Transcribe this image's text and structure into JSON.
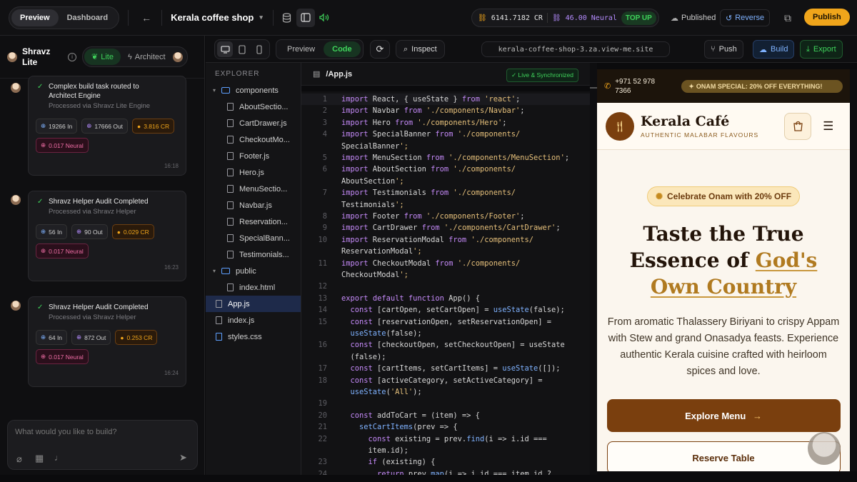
{
  "topbar": {
    "mode_tabs": [
      "Preview",
      "Dashboard"
    ],
    "project_name": "Kerala coffee shop",
    "credits": "6141.7182 CR",
    "neural": "46.00 Neural",
    "topup_label": "TOP UP",
    "published_label": "Published",
    "reverse_label": "Reverse",
    "publish_label": "Publish"
  },
  "chat": {
    "agent_name": "Shravz Lite",
    "modes": [
      "Lite",
      "Architect"
    ],
    "messages": [
      {
        "title": "Complex build task routed to Architect Engine",
        "sub": "Processed via Shravz Lite Engine",
        "tokens_in": "19266 In",
        "tokens_out": "17666 Out",
        "cr": "3.816 CR",
        "neural": "0.017 Neural",
        "time": "16:18"
      },
      {
        "title": "Shravz Helper Audit Completed",
        "sub": "Processed via Shravz Helper",
        "tokens_in": "56 In",
        "tokens_out": "90 Out",
        "cr": "0.029 CR",
        "neural": "0.017 Neural",
        "time": "16:23"
      },
      {
        "title": "Shravz Helper Audit Completed",
        "sub": "Processed via Shravz Helper",
        "tokens_in": "64 In",
        "tokens_out": "872 Out",
        "cr": "0.253 CR",
        "neural": "0.017 Neural",
        "time": "16:24"
      }
    ],
    "composer_placeholder": "What would you like to build?"
  },
  "previewbar": {
    "view_tabs": [
      "Preview",
      "Code"
    ],
    "inspect_label": "Inspect",
    "url": "kerala-coffee-shop-3.za.view-me.site",
    "push_label": "Push",
    "build_label": "Build",
    "export_label": "Export"
  },
  "explorer": {
    "header": "EXPLORER",
    "folder_components": "components",
    "components": [
      "AboutSectio...",
      "CartDrawer.js",
      "CheckoutMo...",
      "Footer.js",
      "Hero.js",
      "MenuSectio...",
      "Navbar.js",
      "Reservation...",
      "SpecialBann...",
      "Testimonials..."
    ],
    "folder_public": "public",
    "public": [
      "index.html"
    ],
    "root": [
      "App.js",
      "index.js",
      "styles.css"
    ]
  },
  "editor": {
    "file": "/App.js",
    "status": "Live & Synchronized",
    "lines": [
      {
        "n": "1",
        "text": "import React, { useState } from 'react';"
      },
      {
        "n": "2",
        "text": "import Navbar from './components/Navbar';"
      },
      {
        "n": "3",
        "text": "import Hero from './components/Hero';"
      },
      {
        "n": "4",
        "text": "import SpecialBanner from './components/"
      },
      {
        "n": "",
        "text": "SpecialBanner';"
      },
      {
        "n": "5",
        "text": "import MenuSection from './components/MenuSection';"
      },
      {
        "n": "6",
        "text": "import AboutSection from './components/"
      },
      {
        "n": "",
        "text": "AboutSection';"
      },
      {
        "n": "7",
        "text": "import Testimonials from './components/"
      },
      {
        "n": "",
        "text": "Testimonials';"
      },
      {
        "n": "8",
        "text": "import Footer from './components/Footer';"
      },
      {
        "n": "9",
        "text": "import CartDrawer from './components/CartDrawer';"
      },
      {
        "n": "10",
        "text": "import ReservationModal from './components/"
      },
      {
        "n": "",
        "text": "ReservationModal';"
      },
      {
        "n": "11",
        "text": "import CheckoutModal from './components/"
      },
      {
        "n": "",
        "text": "CheckoutModal';"
      },
      {
        "n": "12",
        "text": ""
      },
      {
        "n": "13",
        "text": "export default function App() {"
      },
      {
        "n": "14",
        "text": "  const [cartOpen, setCartOpen] = useState(false);"
      },
      {
        "n": "15",
        "text": "  const [reservationOpen, setReservationOpen] ="
      },
      {
        "n": "",
        "text": "  useState(false);"
      },
      {
        "n": "16",
        "text": "  const [checkoutOpen, setCheckoutOpen] = useState"
      },
      {
        "n": "",
        "text": "  (false);"
      },
      {
        "n": "17",
        "text": "  const [cartItems, setCartItems] = useState([]);"
      },
      {
        "n": "18",
        "text": "  const [activeCategory, setActiveCategory] ="
      },
      {
        "n": "",
        "text": "  useState('All');"
      },
      {
        "n": "19",
        "text": ""
      },
      {
        "n": "20",
        "text": "  const addToCart = (item) => {"
      },
      {
        "n": "21",
        "text": "    setCartItems(prev => {"
      },
      {
        "n": "22",
        "text": "      const existing = prev.find(i => i.id ==="
      },
      {
        "n": "",
        "text": "      item.id);"
      },
      {
        "n": "23",
        "text": "      if (existing) {"
      },
      {
        "n": "24",
        "text": "        return prev.map(i => i.id === item.id ?"
      }
    ]
  },
  "site": {
    "phone": "+971 52 978 7366",
    "promo": "ONAM SPECIAL: 20% OFF EVERYTHING!",
    "brand": "Kerala Café",
    "tagline": "AUTHENTIC MALABAR FLAVOURS",
    "badge": "Celebrate Onam with 20% OFF",
    "heading_1": "Taste the True",
    "heading_2": "Essence of",
    "heading_gold_1": "God's",
    "heading_gold_2": "Own Country",
    "paragraph": "From aromatic Thalassery Biriyani to crispy Appam with Stew and grand Onasadya feasts. Experience authentic Kerala cuisine crafted with heirloom spices and love.",
    "cta_primary": "Explore Menu",
    "cta_secondary": "Reserve Table"
  }
}
